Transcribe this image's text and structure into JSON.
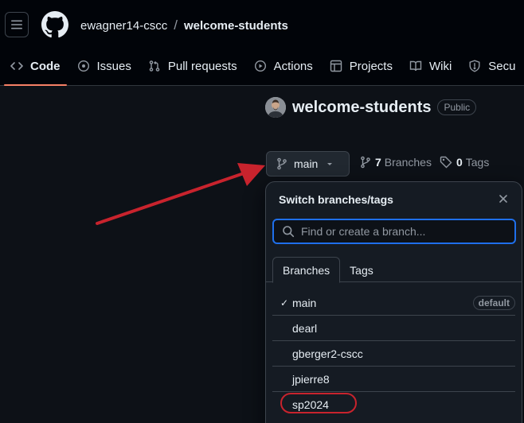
{
  "header": {
    "owner": "ewagner14-cscc",
    "separator": "/",
    "repo": "welcome-students"
  },
  "tabs": [
    {
      "label": "Code",
      "icon": "code-icon",
      "active": true
    },
    {
      "label": "Issues",
      "icon": "issue-icon"
    },
    {
      "label": "Pull requests",
      "icon": "pull-request-icon"
    },
    {
      "label": "Actions",
      "icon": "play-icon"
    },
    {
      "label": "Projects",
      "icon": "table-icon"
    },
    {
      "label": "Wiki",
      "icon": "book-icon"
    },
    {
      "label": "Secu",
      "icon": "shield-icon"
    }
  ],
  "repo": {
    "name": "welcome-students",
    "visibility": "Public"
  },
  "branch_button": {
    "label": "main"
  },
  "meta": {
    "branches_count": "7",
    "branches_label": "Branches",
    "tags_count": "0",
    "tags_label": "Tags"
  },
  "switcher": {
    "title": "Switch branches/tags",
    "filter_placeholder": "Find or create a branch...",
    "tabs": [
      "Branches",
      "Tags"
    ],
    "branches": [
      {
        "name": "main",
        "checked": true,
        "badge": "default"
      },
      {
        "name": "dearl"
      },
      {
        "name": "gberger2-cscc"
      },
      {
        "name": "jpierre8"
      },
      {
        "name": "sp2024",
        "highlighted": true
      }
    ],
    "check_glyph": "✓"
  },
  "colors": {
    "background": "#0d1117",
    "header": "#010409",
    "accent_tab": "#f78166",
    "focus": "#1f6feb",
    "annotation": "#c8232d"
  }
}
